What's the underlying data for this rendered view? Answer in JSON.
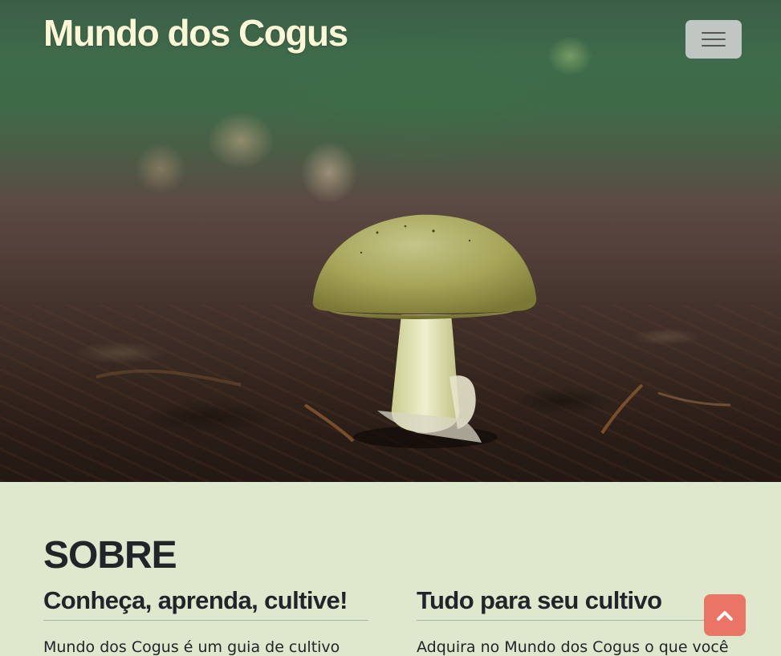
{
  "header": {
    "brand": "Mundo dos Cogus",
    "menu_icon": "hamburger-icon"
  },
  "hero": {
    "image": "mushroom-photo"
  },
  "about": {
    "heading": "SOBRE",
    "columns": [
      {
        "title": "Conheça, aprenda, cultive!",
        "text": "Mundo dos Cogus é um guia de cultivo"
      },
      {
        "title": "Tudo para seu cultivo",
        "text": "Adquira no Mundo dos Cogus o que você"
      }
    ]
  },
  "back_to_top": {
    "icon": "chevron-up-icon"
  },
  "colors": {
    "brand_text": "#fbf7d7",
    "section_bg": "#dde8cd",
    "accent": "#ea7565",
    "text": "#212529"
  }
}
